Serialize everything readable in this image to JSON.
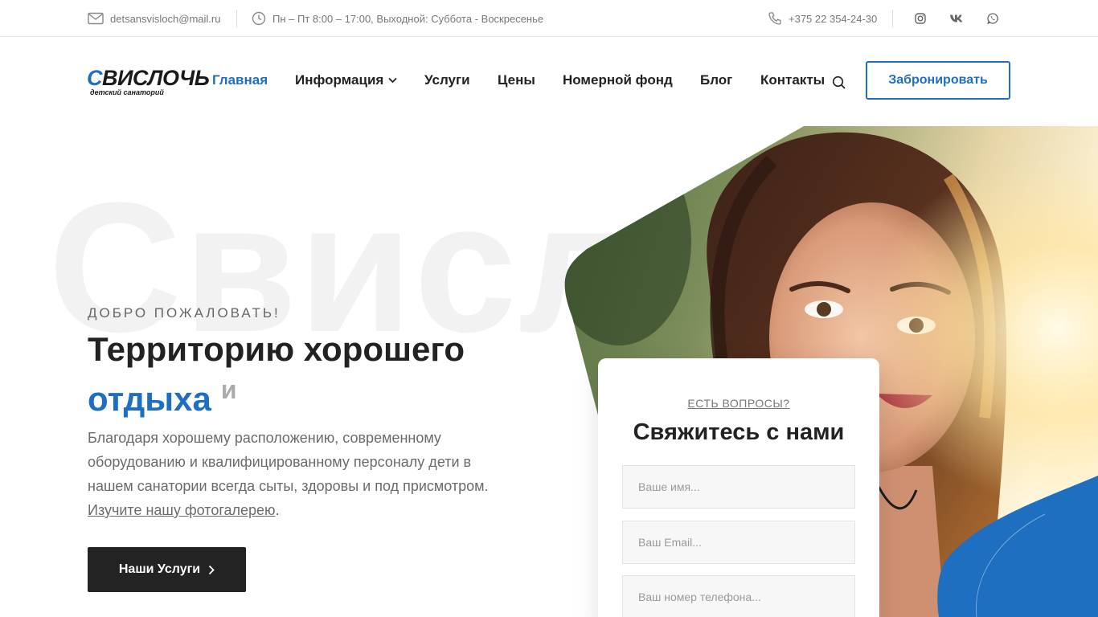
{
  "topbar": {
    "email": "detsansvisloch@mail.ru",
    "hours": "Пн – Пт 8:00 – 17:00, Выходной: Суббота - Воскресенье",
    "phone": "+375 22 354-24-30",
    "social": [
      "instagram-icon",
      "vk-icon",
      "whatsapp-icon"
    ]
  },
  "logo": {
    "main_first": "С",
    "main_rest": "ВИСЛОЧЬ",
    "sub": "детский санаторий"
  },
  "nav": {
    "items": [
      {
        "label": "Главная",
        "active": true
      },
      {
        "label": "Информация",
        "dropdown": true
      },
      {
        "label": "Услуги"
      },
      {
        "label": "Цены"
      },
      {
        "label": "Номерной фонд"
      },
      {
        "label": "Блог"
      },
      {
        "label": "Контакты"
      }
    ],
    "book_label": "Забронировать"
  },
  "hero": {
    "bigword": "Свисл",
    "eyebrow": "ДОБРО ПОЖАЛОВАТЬ!",
    "headline_line1": "Территорию хорошего",
    "headline_accent": "отдыха",
    "headline_small": "и",
    "lead_text": "Благодаря хорошему расположению, современному оборудованию и квалифицированному персоналу дети в нашем санатории всегда сыты, здоровы и под присмотром.",
    "lead_link": "Изучите нашу фотогалерею",
    "lead_end": ".",
    "cta_label": "Наши Услуги"
  },
  "form": {
    "eyebrow": "ЕСТЬ ВОПРОСЫ?",
    "title": "Свяжитесь с нами",
    "name_placeholder": "Ваше имя...",
    "email_placeholder": "Ваш Email...",
    "phone_placeholder": "Ваш номер телефона..."
  },
  "colors": {
    "accent": "#1e6fc0",
    "dark": "#232323",
    "muted": "#6b6b6b"
  }
}
